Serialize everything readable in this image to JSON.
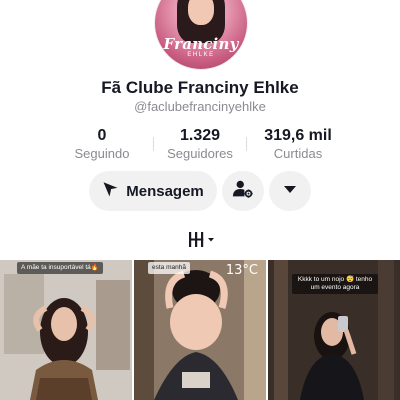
{
  "profile": {
    "avatar_brand": "Franciny",
    "avatar_brand_sub": "EHLKE",
    "name": "Fã Clube Franciny Ehlke",
    "handle": "@faclubefrancinyehlke"
  },
  "stats": [
    {
      "value": "0",
      "label": "Seguindo"
    },
    {
      "value": "1.329",
      "label": "Seguidores"
    },
    {
      "value": "319,6 mil",
      "label": "Curtidas"
    }
  ],
  "actions": {
    "message_label": "Mensagem",
    "message_icon": "send-icon",
    "user_icon": "user-settings-icon",
    "more_icon": "chevron-down-icon"
  },
  "tabs": {
    "videos_icon": "videos-grid-icon"
  },
  "videos": [
    {
      "caption": "A mãe ta insuportável tá🔥"
    },
    {
      "caption": "esta manhã",
      "overlay": "13°C"
    },
    {
      "caption": "Kkkk to um nojo 😴 tenho um evento agora"
    }
  ],
  "colors": {
    "text": "#161823",
    "muted": "#8a8b91",
    "button_bg": "#f1f1f2"
  }
}
